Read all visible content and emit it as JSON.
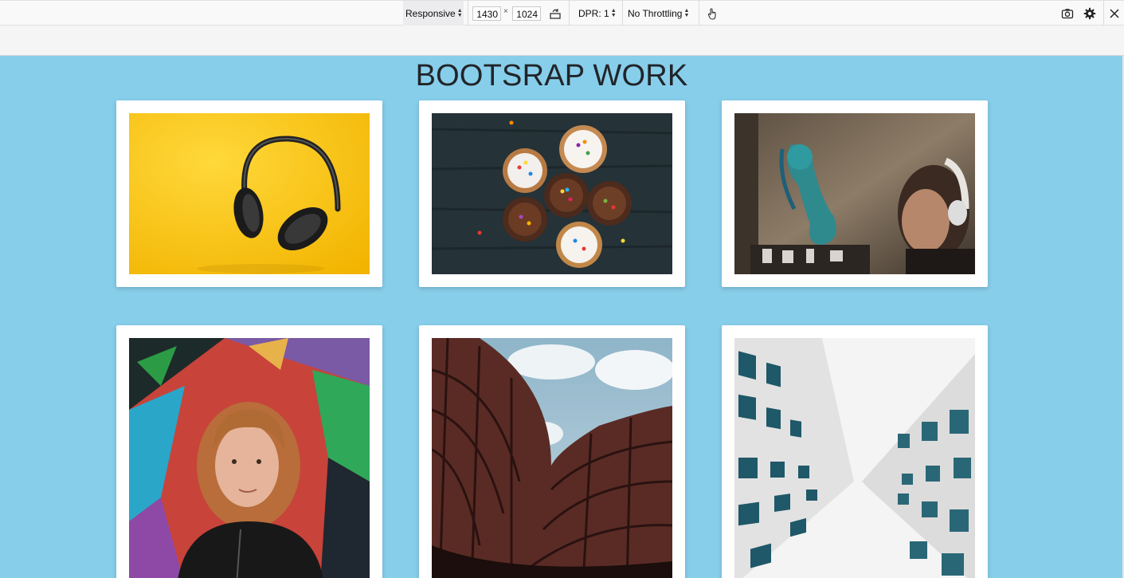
{
  "toolbar": {
    "device": "Responsive",
    "width": "1430",
    "times": "×",
    "height": "1024",
    "dpr": "DPR: 1",
    "throttling": "No Throttling",
    "icons": [
      "rotate-icon",
      "touch-icon",
      "screenshot-icon",
      "settings-icon",
      "close-icon"
    ]
  },
  "page": {
    "title": "BOOTSRAP WORK",
    "background": "#87ceeb",
    "cards": [
      {
        "alt": "Headphones on yellow background"
      },
      {
        "alt": "Cupcakes on dark wood"
      },
      {
        "alt": "Graffiti wall with person wearing headphones"
      },
      {
        "alt": "Person in front of colorful graffiti"
      },
      {
        "alt": "Curved building facade"
      },
      {
        "alt": "White modern buildings from below"
      }
    ]
  }
}
